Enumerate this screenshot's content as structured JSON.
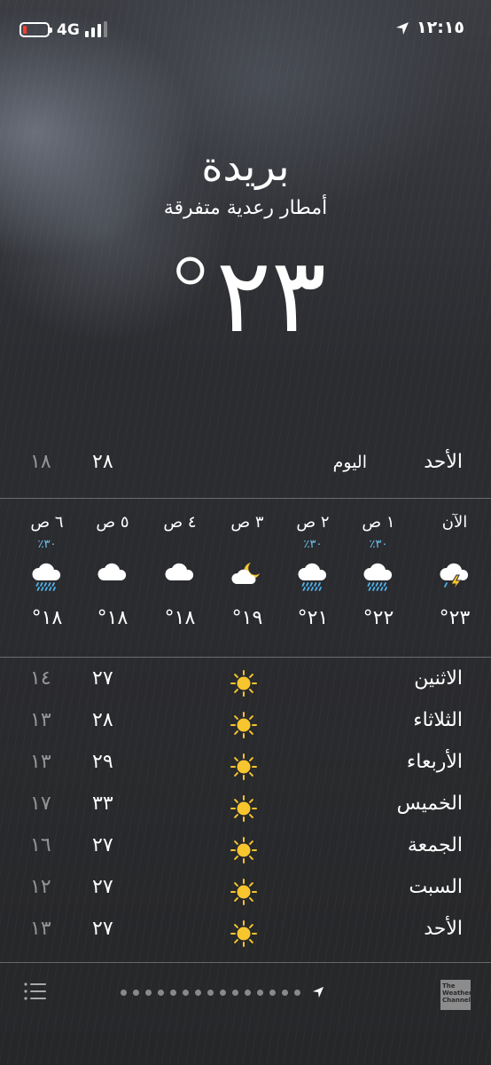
{
  "status_bar": {
    "network": "4G",
    "time": "١٢:١٥",
    "battery_color": "#ff3b30"
  },
  "header": {
    "city": "بريدة",
    "condition": "أمطار رعدية متفرقة",
    "temperature": "°٢٣"
  },
  "today": {
    "day": "الأحد",
    "label": "اليوم",
    "high": "٢٨",
    "low": "١٨"
  },
  "hourly": [
    {
      "label": "الآن",
      "precip": "",
      "icon": "thunderstorm-icon",
      "temp": "°٢٣"
    },
    {
      "label": "١ ص",
      "precip": "٪٣٠",
      "icon": "rain-cloud-icon",
      "temp": "°٢٢"
    },
    {
      "label": "٢ ص",
      "precip": "٪٣٠",
      "icon": "rain-cloud-icon",
      "temp": "°٢١"
    },
    {
      "label": "٣ ص",
      "precip": "",
      "icon": "partly-cloudy-night-icon",
      "temp": "°١٩"
    },
    {
      "label": "٤ ص",
      "precip": "",
      "icon": "cloud-icon",
      "temp": "°١٨"
    },
    {
      "label": "٥ ص",
      "precip": "",
      "icon": "cloud-icon",
      "temp": "°١٨"
    },
    {
      "label": "٦ ص",
      "precip": "٪٣٠",
      "icon": "rain-cloud-icon",
      "temp": "°١٨"
    }
  ],
  "daily": [
    {
      "day": "الاثنين",
      "icon": "sun-icon",
      "high": "٢٧",
      "low": "١٤"
    },
    {
      "day": "الثلاثاء",
      "icon": "sun-icon",
      "high": "٢٨",
      "low": "١٣"
    },
    {
      "day": "الأربعاء",
      "icon": "sun-icon",
      "high": "٢٩",
      "low": "١٣"
    },
    {
      "day": "الخميس",
      "icon": "sun-icon",
      "high": "٣٣",
      "low": "١٧"
    },
    {
      "day": "الجمعة",
      "icon": "sun-icon",
      "high": "٢٧",
      "low": "١٦"
    },
    {
      "day": "السبت",
      "icon": "sun-icon",
      "high": "٢٧",
      "low": "١٢"
    },
    {
      "day": "الأحد",
      "icon": "sun-icon",
      "high": "٢٧",
      "low": "١٣"
    }
  ],
  "bottom_bar": {
    "logo_text": "The Weather Channel"
  },
  "colors": {
    "precip_text": "#6ec6f5",
    "sun": "#f7c52e",
    "rain_drops": "#4fb3f0"
  }
}
